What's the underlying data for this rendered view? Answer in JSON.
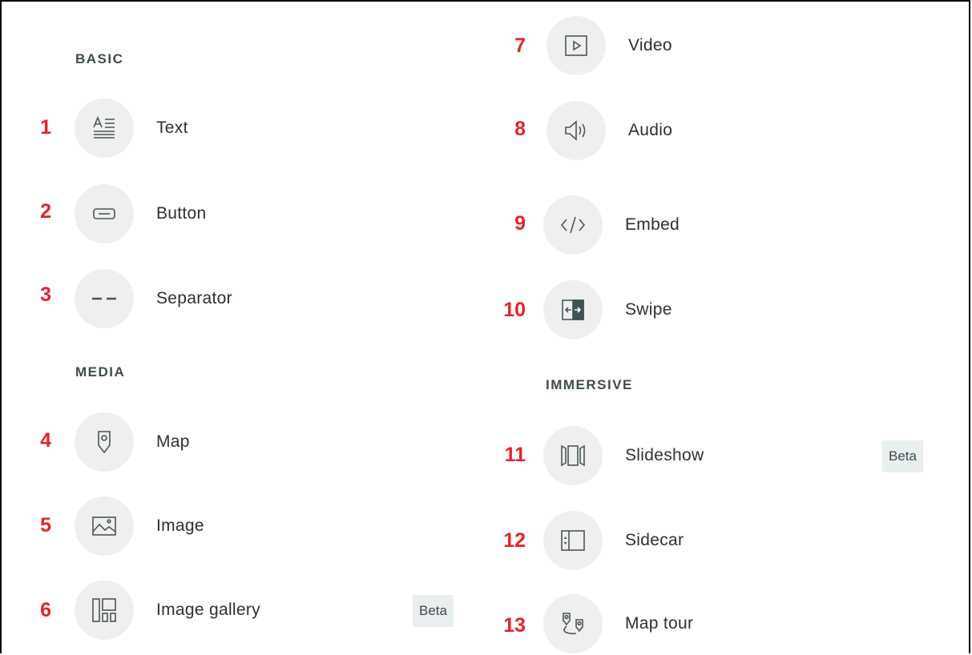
{
  "sections": {
    "basic": "BASIC",
    "media": "MEDIA",
    "immersive": "IMMERSIVE"
  },
  "items": [
    {
      "num": "1",
      "label": "Text",
      "icon": "text-icon"
    },
    {
      "num": "2",
      "label": "Button",
      "icon": "button-icon"
    },
    {
      "num": "3",
      "label": "Separator",
      "icon": "separator-icon"
    },
    {
      "num": "4",
      "label": "Map",
      "icon": "map-pin-icon"
    },
    {
      "num": "5",
      "label": "Image",
      "icon": "image-icon"
    },
    {
      "num": "6",
      "label": "Image gallery",
      "icon": "gallery-icon",
      "badge": "Beta"
    },
    {
      "num": "7",
      "label": "Video",
      "icon": "video-icon"
    },
    {
      "num": "8",
      "label": "Audio",
      "icon": "audio-icon"
    },
    {
      "num": "9",
      "label": "Embed",
      "icon": "embed-code-icon"
    },
    {
      "num": "10",
      "label": "Swipe",
      "icon": "swipe-icon"
    },
    {
      "num": "11",
      "label": "Slideshow",
      "icon": "slideshow-icon",
      "badge": "Beta"
    },
    {
      "num": "12",
      "label": "Sidecar",
      "icon": "sidecar-icon"
    },
    {
      "num": "13",
      "label": "Map tour",
      "icon": "map-tour-icon"
    }
  ],
  "colors": {
    "annotation_red": "#e3242b",
    "icon_stroke": "#4a5656",
    "circle_bg": "#efefef",
    "badge_bg": "#e9eeee"
  }
}
